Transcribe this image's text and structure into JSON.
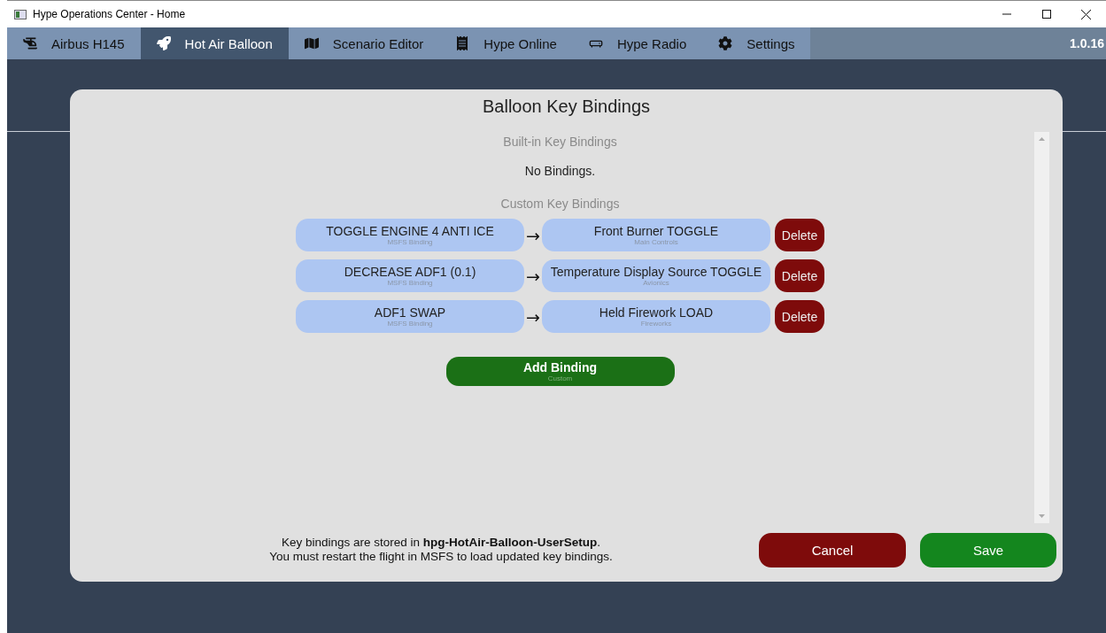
{
  "window": {
    "title": "Hype Operations Center - Home"
  },
  "tabs": [
    {
      "label": "Airbus H145",
      "selected": false
    },
    {
      "label": "Hot Air Balloon",
      "selected": true
    },
    {
      "label": "Scenario Editor",
      "selected": false
    },
    {
      "label": "Hype Online",
      "selected": false
    },
    {
      "label": "Hype Radio",
      "selected": false
    },
    {
      "label": "Settings",
      "selected": false
    }
  ],
  "version": "1.0.16",
  "dialog": {
    "title": "Balloon Key Bindings",
    "builtin_heading": "Built-in Key Bindings",
    "builtin_empty": "No Bindings.",
    "custom_heading": "Custom Key Bindings",
    "bindings": [
      {
        "source": "TOGGLE ENGINE 4 ANTI ICE",
        "source_type": "MSFS Binding",
        "arrow": "→",
        "target": "Front Burner TOGGLE",
        "target_group": "Main Controls",
        "delete": "Delete"
      },
      {
        "source": "DECREASE ADF1 (0.1)",
        "source_type": "MSFS Binding",
        "arrow": "→",
        "target": "Temperature Display Source TOGGLE",
        "target_group": "Avionics",
        "delete": "Delete"
      },
      {
        "source": "ADF1 SWAP",
        "source_type": "MSFS Binding",
        "arrow": "→",
        "target": "Held Firework LOAD",
        "target_group": "Fireworks",
        "delete": "Delete"
      }
    ],
    "add_button": {
      "label": "Add Binding",
      "sub": "Custom"
    },
    "note": "Key bindings are stored in **hpg-HotAir-Balloon-UserSetup**.\nYou must restart the flight in MSFS to load updated key bindings.",
    "cancel": "Cancel",
    "save": "Save"
  }
}
